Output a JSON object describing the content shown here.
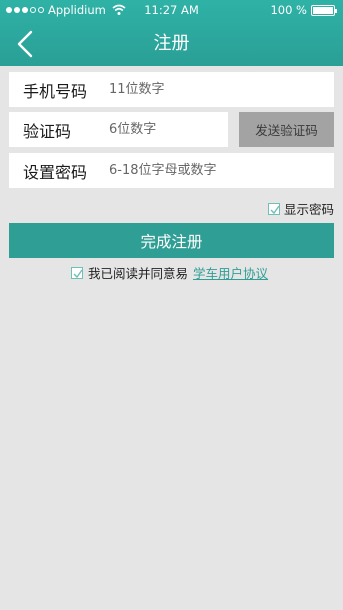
{
  "status_bar": {
    "carrier": "Applidium",
    "time": "11:27 AM",
    "battery_text": "100 %",
    "battery_level": 1.0,
    "signal_bars_filled": 3,
    "signal_bars_total": 5
  },
  "nav": {
    "title": "注册",
    "back_icon": "chevron-left-icon"
  },
  "form": {
    "phone": {
      "label": "手机号码",
      "placeholder": "11位数字"
    },
    "code": {
      "label": "验证码",
      "placeholder": "6位数字",
      "button": "发送验证码"
    },
    "password": {
      "label": "设置密码",
      "placeholder": "6-18位字母或数字"
    },
    "show_password": "显示密码",
    "submit": "完成注册",
    "agreement_prefix": "我已阅读并同意易",
    "agreement_link": "学车用户协议"
  },
  "colors": {
    "accent": "#2f9e95",
    "background": "#e6e5e5",
    "code_button_bg": "#a3a3a3"
  }
}
